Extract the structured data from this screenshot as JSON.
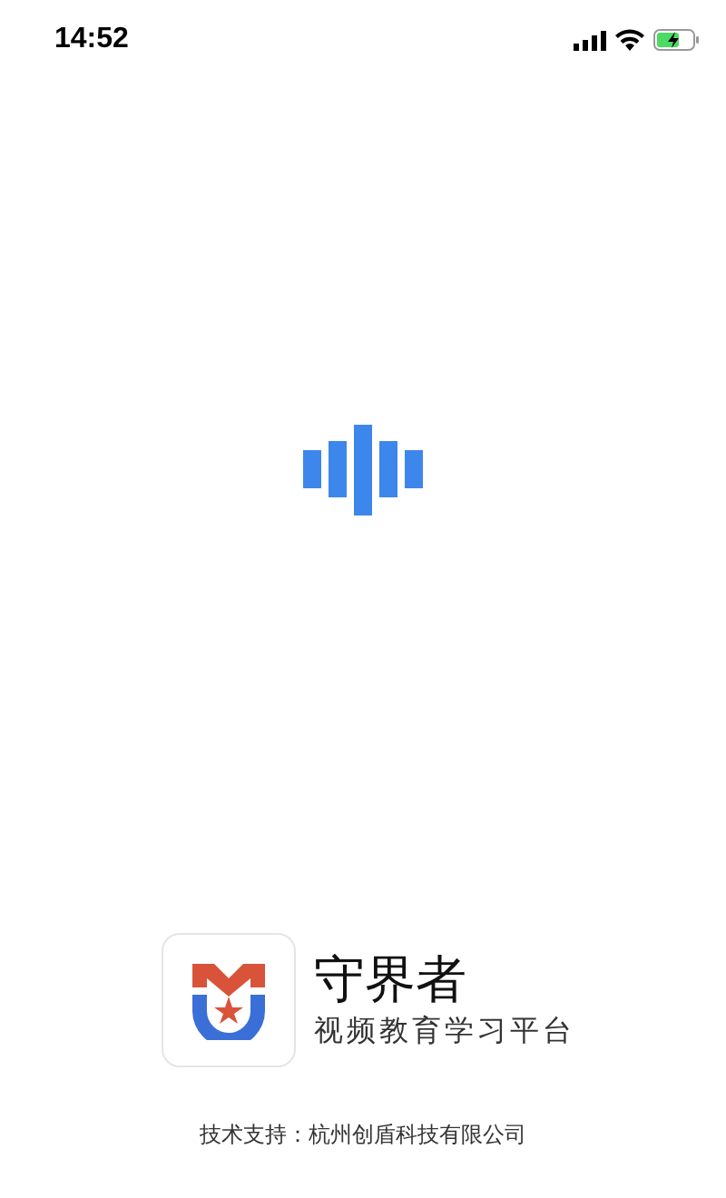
{
  "status_bar": {
    "time": "14:52"
  },
  "app": {
    "name": "守界者",
    "tagline": "视频教育学习平台"
  },
  "footer": "技术支持：杭州创盾科技有限公司"
}
